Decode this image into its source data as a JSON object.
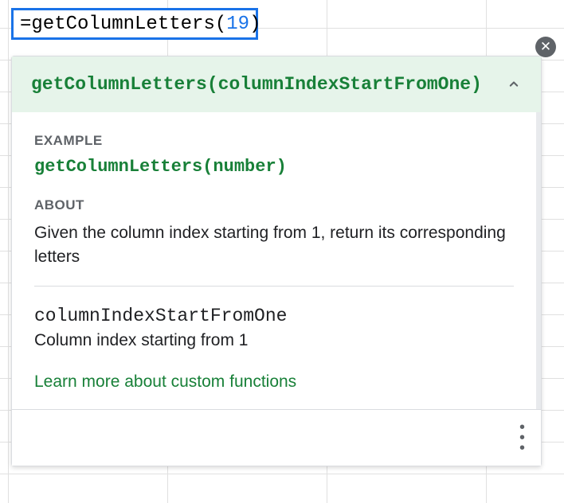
{
  "cell": {
    "equals": "=",
    "function_name": "getColumnLetters",
    "open_paren": "(",
    "argument": "19",
    "close_paren": ")"
  },
  "close_button": "✕",
  "tooltip": {
    "signature": "getColumnLetters(columnIndexStartFromOne)",
    "example_label": "EXAMPLE",
    "example_code": "getColumnLetters(number)",
    "about_label": "ABOUT",
    "about_text": "Given the column index starting from 1, return its corresponding letters",
    "param_name": "columnIndexStartFromOne",
    "param_desc": "Column index starting from 1",
    "learn_more": "Learn more about custom functions"
  }
}
